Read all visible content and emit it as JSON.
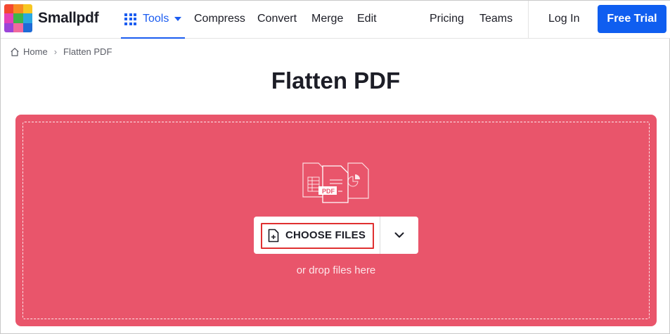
{
  "brand": {
    "name": "Smallpdf",
    "logo_colors": [
      "#f4482f",
      "#f88c22",
      "#f7c722",
      "#3cb54a",
      "#2aa8e0",
      "#1e6bd6",
      "#9b44d8",
      "#e440b6",
      "#f06a9d"
    ]
  },
  "nav": {
    "tools_label": "Tools",
    "links": [
      "Compress",
      "Convert",
      "Merge",
      "Edit",
      "Pricing",
      "Teams"
    ],
    "login_label": "Log In",
    "trial_label": "Free Trial"
  },
  "breadcrumb": {
    "home": "Home",
    "separator": "›",
    "current": "Flatten PDF"
  },
  "page": {
    "title": "Flatten PDF"
  },
  "dropzone": {
    "choose_label": "CHOOSE FILES",
    "drop_hint": "or drop files here",
    "illustration_badge": "PDF",
    "background_color": "#e9556b",
    "highlight_color": "#e03030"
  },
  "colors": {
    "accent": "#1b5cf0",
    "trial_bg": "#0f5ef0"
  }
}
